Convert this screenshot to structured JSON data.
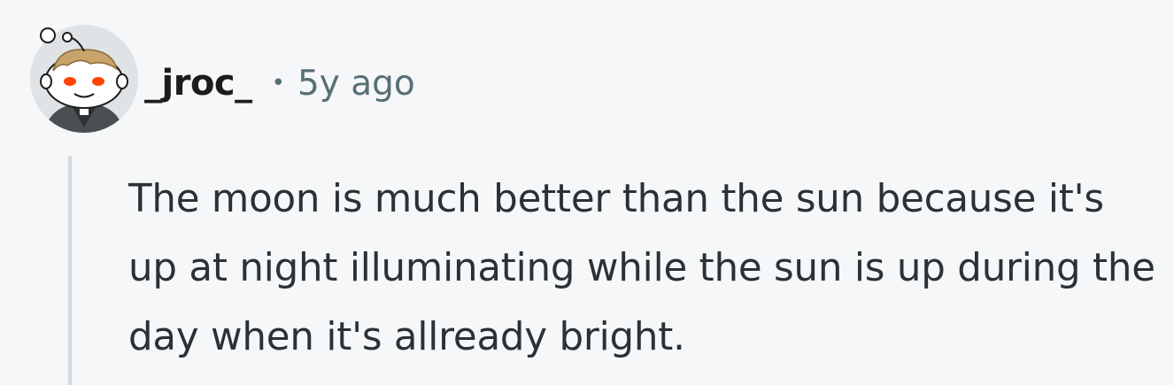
{
  "comment": {
    "author": "_jroc_",
    "separator": "•",
    "timestamp": "5y ago",
    "avatar_icon": "snoo-avatar-icon",
    "body": "The moon is much better than the sun because it's up at night illuminating while the sun is up during the day when it's allready bright."
  },
  "colors": {
    "background": "#f6f7f8",
    "text": "#2a3236",
    "meta": "#576f76",
    "thread_line": "#d5dadc"
  }
}
